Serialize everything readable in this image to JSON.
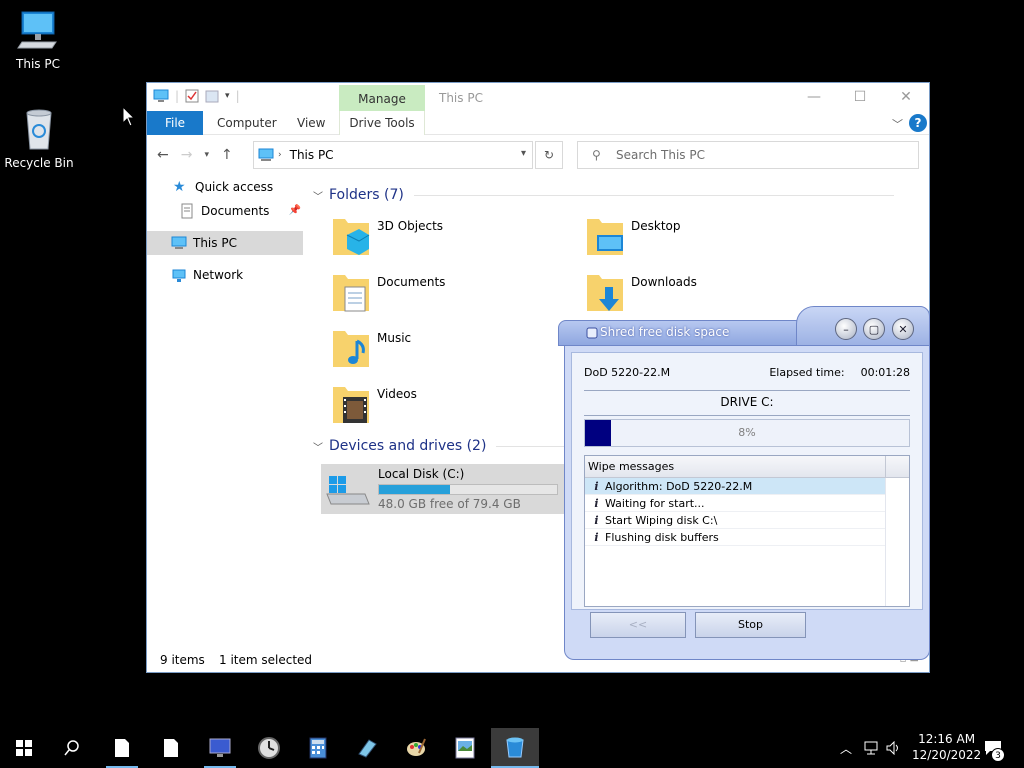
{
  "desktop": {
    "icons": [
      {
        "label": "This PC"
      },
      {
        "label": "Recycle Bin"
      }
    ]
  },
  "explorer": {
    "title": "This PC",
    "ribbon": {
      "manage_tab": "Manage",
      "file_tab": "File",
      "computer_tab": "Computer",
      "view_tab": "View",
      "drive_tools_tab": "Drive Tools"
    },
    "address": "This PC",
    "search_placeholder": "Search This PC",
    "nav": {
      "quick_access": "Quick access",
      "documents": "Documents",
      "this_pc": "This PC",
      "network": "Network"
    },
    "folders_header": "Folders (7)",
    "folders": [
      {
        "label": "3D Objects"
      },
      {
        "label": "Desktop"
      },
      {
        "label": "Documents"
      },
      {
        "label": "Downloads"
      },
      {
        "label": "Music"
      },
      {
        "label": "Videos"
      }
    ],
    "devices_header": "Devices and drives (2)",
    "drive": {
      "label": "Local Disk (C:)",
      "free_text": "48.0 GB free of 79.4 GB",
      "used_fraction": 0.4
    },
    "status": {
      "items": "9 items",
      "selected": "1 item selected"
    }
  },
  "shred_dialog": {
    "title": "Shred free disk space",
    "algorithm": "DoD 5220-22.M",
    "elapsed_label": "Elapsed time:",
    "elapsed_value": "00:01:28",
    "drive_label": "DRIVE C:",
    "progress_percent": 8,
    "progress_text": "8%",
    "messages_header": "Wipe messages",
    "messages": [
      {
        "text": "Algorithm: DoD 5220-22.M"
      },
      {
        "text": "Waiting for start..."
      },
      {
        "text": "Start Wiping disk C:\\"
      },
      {
        "text": "Flushing disk buffers"
      }
    ],
    "back_button": "<<",
    "stop_button": "Stop"
  },
  "taskbar": {
    "time": "12:16 AM",
    "date": "12/20/2022",
    "notification_count": "3"
  },
  "colors": {
    "ribbon_file": "#1979ca",
    "manage_tab": "#c9ebc1",
    "progress_fill": "#000080",
    "drive_fill": "#26a0da"
  }
}
